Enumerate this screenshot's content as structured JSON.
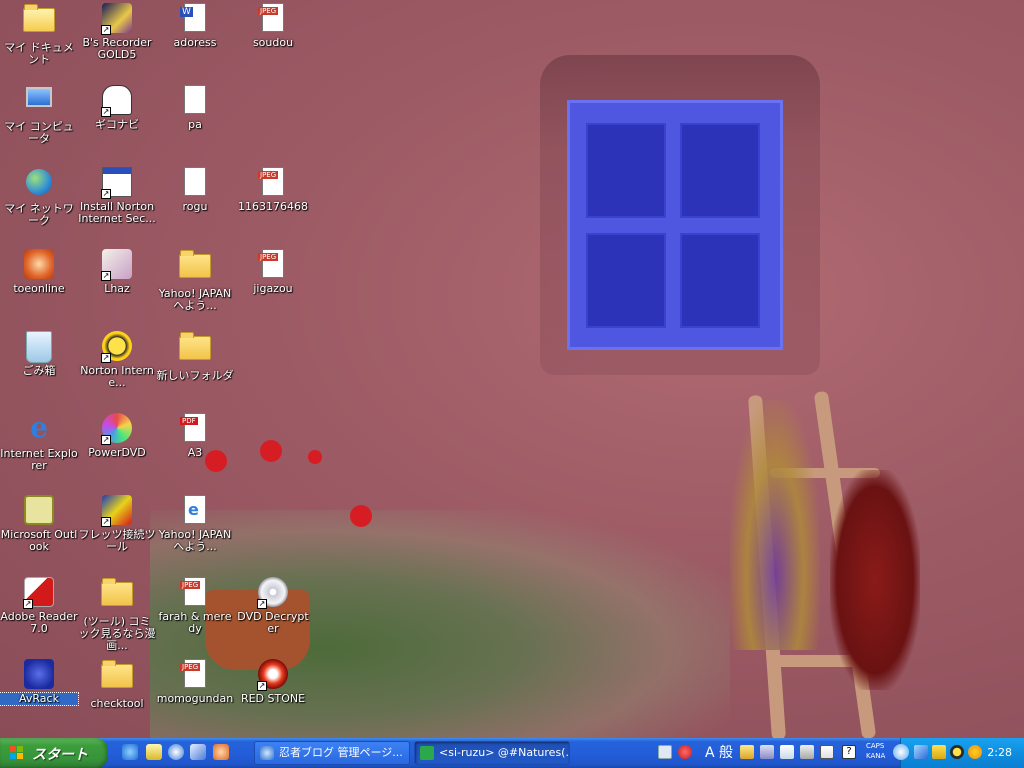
{
  "desktop": {
    "icons": [
      {
        "label": "マイ ドキュメント"
      },
      {
        "label": "B's Recorder GOLD5"
      },
      {
        "label": "adoress"
      },
      {
        "label": "soudou"
      },
      {
        "label": "マイ コンピュータ"
      },
      {
        "label": "ギコナビ"
      },
      {
        "label": "pa"
      },
      {
        "label": "マイ ネットワーク"
      },
      {
        "label": "Install Norton Internet Sec..."
      },
      {
        "label": "rogu"
      },
      {
        "label": "1163176468"
      },
      {
        "label": "toeonline"
      },
      {
        "label": "Lhaz"
      },
      {
        "label": "Yahoo! JAPANへよう..."
      },
      {
        "label": "jigazou"
      },
      {
        "label": "ごみ箱"
      },
      {
        "label": "Norton Interne..."
      },
      {
        "label": "新しいフォルダ"
      },
      {
        "label": "Internet Explorer"
      },
      {
        "label": "PowerDVD"
      },
      {
        "label": "A3"
      },
      {
        "label": "Microsoft Outlook"
      },
      {
        "label": "フレッツ接続ツール"
      },
      {
        "label": "Yahoo! JAPANへよう..."
      },
      {
        "label": "Adobe Reader 7.0"
      },
      {
        "label": "(ツール) コミック見るなら漫画..."
      },
      {
        "label": "farah & meredy"
      },
      {
        "label": "DVD Decrypter"
      },
      {
        "label": "AvRack"
      },
      {
        "label": "checktool"
      },
      {
        "label": "momogundan"
      },
      {
        "label": "RED STONE"
      }
    ]
  },
  "taskbar": {
    "start_label": "スタート",
    "tasks": [
      {
        "label": "忍者ブログ 管理ページ..."
      },
      {
        "label": "<si-ruzu> @#Natures(..."
      }
    ],
    "ime_label": "A 般",
    "caps_label": "CAPS KANA",
    "clock": "2:28"
  },
  "colors": {
    "taskbar_blue": "#245edb",
    "start_green": "#3c9d3c",
    "tray_blue": "#0f8ee0",
    "selection_blue": "#316ac5"
  }
}
